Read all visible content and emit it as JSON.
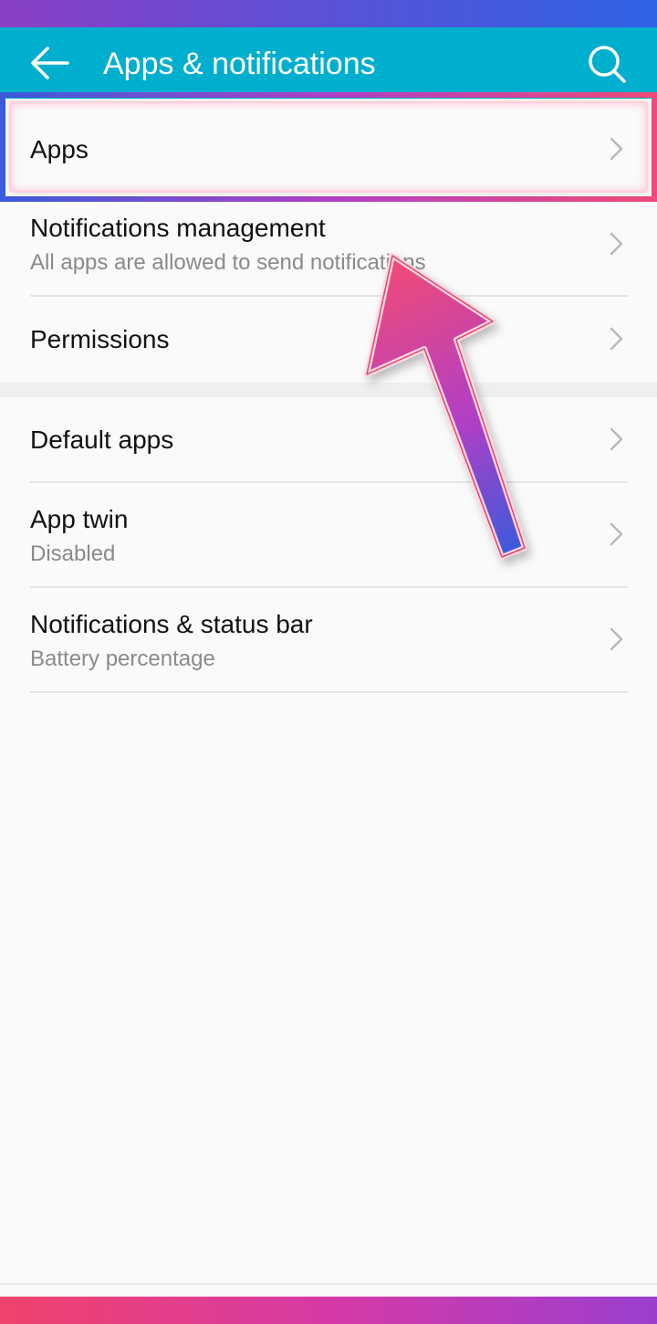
{
  "header": {
    "title": "Apps & notifications",
    "back_icon": "arrow-left-icon",
    "search_icon": "search-icon",
    "color": "#00aecd"
  },
  "items": [
    {
      "title": "Apps"
    },
    {
      "title": "Notifications management",
      "subtitle": "All apps are allowed to send notifications"
    },
    {
      "title": "Permissions"
    },
    {
      "title": "Default apps"
    },
    {
      "title": "App twin",
      "subtitle": "Disabled"
    },
    {
      "title": "Notifications & status bar",
      "subtitle": "Battery percentage"
    }
  ],
  "annotation": {
    "highlight_target": "Apps",
    "colors": [
      "#3b5bdb",
      "#b13fc5",
      "#ef4a79"
    ]
  }
}
